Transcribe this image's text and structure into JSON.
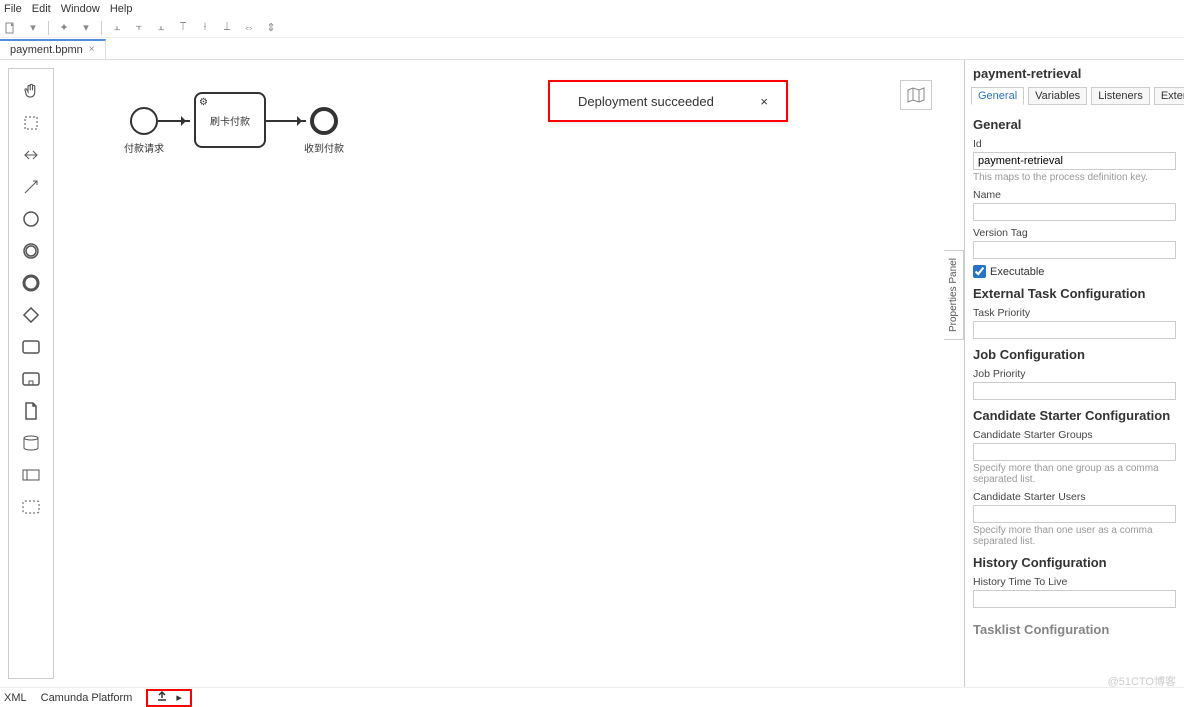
{
  "menubar": {
    "file": "File",
    "edit": "Edit",
    "window": "Window",
    "help": "Help"
  },
  "tab": {
    "label": "payment.bpmn",
    "close": "×"
  },
  "toast": {
    "message": "Deployment succeeded",
    "close": "×"
  },
  "propsToggle": "Properties Panel",
  "diagram": {
    "start_label": "付款请求",
    "task_label": "刷卡付款",
    "end_label": "收到付款"
  },
  "props": {
    "title": "payment-retrieval",
    "tabs": {
      "general": "General",
      "variables": "Variables",
      "listeners": "Listeners",
      "extensions": "Extensions"
    },
    "general": {
      "heading": "General",
      "id_label": "Id",
      "id_value": "payment-retrieval",
      "id_hint": "This maps to the process definition key.",
      "name_label": "Name",
      "name_value": "",
      "version_label": "Version Tag",
      "version_value": "",
      "exec_label": "Executable",
      "exec_checked": true
    },
    "ext": {
      "heading": "External Task Configuration",
      "priority_label": "Task Priority",
      "priority_value": ""
    },
    "job": {
      "heading": "Job Configuration",
      "priority_label": "Job Priority",
      "priority_value": ""
    },
    "cand": {
      "heading": "Candidate Starter Configuration",
      "groups_label": "Candidate Starter Groups",
      "groups_value": "",
      "groups_hint": "Specify more than one group as a comma separated list.",
      "users_label": "Candidate Starter Users",
      "users_value": "",
      "users_hint": "Specify more than one user as a comma separated list."
    },
    "hist": {
      "heading": "History Configuration",
      "ttl_label": "History Time To Live",
      "ttl_value": ""
    },
    "tasklist": {
      "heading": "Tasklist Configuration"
    }
  },
  "footer": {
    "xml": "XML",
    "platform": "Camunda Platform"
  },
  "watermark": "@51CTO博客"
}
